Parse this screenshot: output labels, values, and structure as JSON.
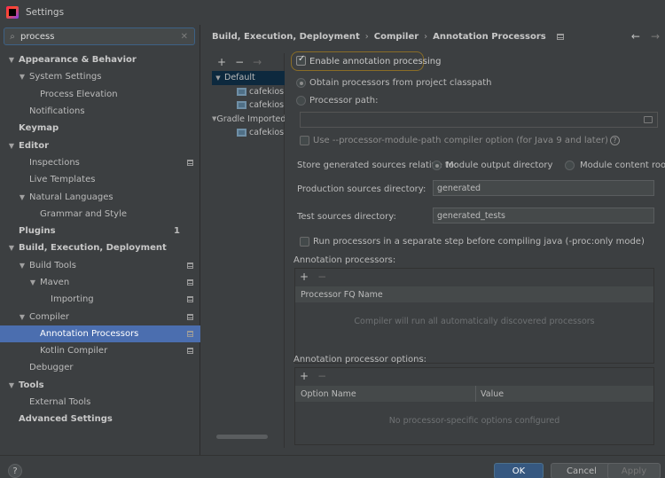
{
  "window": {
    "title": "Settings"
  },
  "search": {
    "value": "process",
    "icon": "search-icon",
    "clear_icon": "close-icon"
  },
  "tree": [
    {
      "label": "Appearance & Behavior",
      "bold": true,
      "chevron": "down",
      "indent": 0
    },
    {
      "label": "System Settings",
      "chevron": "down",
      "indent": 1
    },
    {
      "label": "Process Elevation",
      "indent": 2
    },
    {
      "label": "Notifications",
      "indent": 1
    },
    {
      "label": "Keymap",
      "bold": true,
      "indent": 0
    },
    {
      "label": "Editor",
      "bold": true,
      "chevron": "down",
      "indent": 0
    },
    {
      "label": "Inspections",
      "indent": 1,
      "settings_icon": true
    },
    {
      "label": "Live Templates",
      "indent": 1
    },
    {
      "label": "Natural Languages",
      "chevron": "down",
      "indent": 1
    },
    {
      "label": "Grammar and Style",
      "indent": 2
    },
    {
      "label": "Plugins",
      "bold": true,
      "indent": 0,
      "badge": "1"
    },
    {
      "label": "Build, Execution, Deployment",
      "bold": true,
      "chevron": "down",
      "indent": 0
    },
    {
      "label": "Build Tools",
      "chevron": "down",
      "indent": 1,
      "settings_icon": true
    },
    {
      "label": "Maven",
      "chevron": "down",
      "indent": 2,
      "settings_icon": true
    },
    {
      "label": "Importing",
      "indent": 3,
      "settings_icon": true
    },
    {
      "label": "Compiler",
      "chevron": "down",
      "indent": 1,
      "settings_icon": true
    },
    {
      "label": "Annotation Processors",
      "indent": 2,
      "settings_icon": true,
      "selected": true
    },
    {
      "label": "Kotlin Compiler",
      "indent": 2,
      "settings_icon": true
    },
    {
      "label": "Debugger",
      "indent": 1
    },
    {
      "label": "Tools",
      "bold": true,
      "chevron": "down",
      "indent": 0
    },
    {
      "label": "External Tools",
      "indent": 1
    },
    {
      "label": "Advanced Settings",
      "bold": true,
      "indent": 0
    }
  ],
  "breadcrumb": {
    "items": [
      "Build, Execution, Deployment",
      "Compiler",
      "Annotation Processors"
    ],
    "separator": "›"
  },
  "nav": {
    "back": "←",
    "forward": "→"
  },
  "profiles": {
    "toolbar": [
      "+",
      "−",
      "→"
    ],
    "rows": [
      {
        "label": "Default",
        "chevron": "down",
        "level": 0
      },
      {
        "label": "cafekiosk",
        "level": 1,
        "module": true
      },
      {
        "label": "cafekiosk",
        "level": 1,
        "module": true
      },
      {
        "label": "Gradle Imported",
        "chevron": "down",
        "level": 0
      },
      {
        "label": "cafekiosk",
        "level": 1,
        "module": true
      }
    ]
  },
  "options": {
    "enable_label": "Enable annotation processing",
    "enable_checked": true,
    "obtain_label": "Obtain processors from project classpath",
    "processor_path_label": "Processor path:",
    "processor_path_value": "",
    "module_path_label": "Use --processor-module-path compiler option (for Java 9 and later)",
    "store_label": "Store generated sources relative to:",
    "module_output_label": "Module output directory",
    "module_content_label": "Module content root",
    "production_label": "Production sources directory:",
    "production_value": "generated",
    "test_label": "Test sources directory:",
    "test_value": "generated_tests",
    "separate_step_label": "Run processors in a separate step before compiling java (-proc:only mode)"
  },
  "processors_table": {
    "title": "Annotation processors:",
    "column": "Processor FQ Name",
    "empty_text": "Compiler will run all automatically discovered processors"
  },
  "options_table": {
    "title": "Annotation processor options:",
    "columns": [
      "Option Name",
      "Value"
    ],
    "empty_text": "No processor-specific options configured"
  },
  "buttons": {
    "ok": "OK",
    "cancel": "Cancel",
    "apply": "Apply",
    "help": "?"
  },
  "colors": {
    "selection": "#4b6eaf",
    "primary_button": "#365880",
    "focus_outline": "#8a6d26"
  }
}
